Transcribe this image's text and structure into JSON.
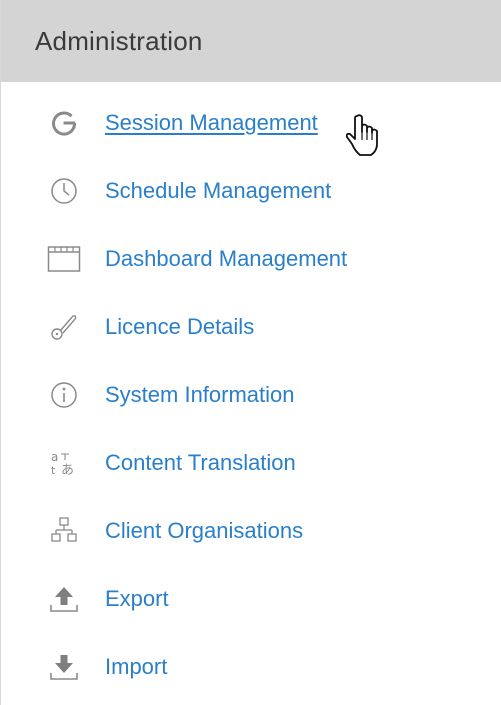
{
  "panel": {
    "title": "Administration"
  },
  "menu": {
    "items": [
      {
        "label": "Session Management",
        "icon": "session-icon",
        "active": true
      },
      {
        "label": "Schedule Management",
        "icon": "clock-icon"
      },
      {
        "label": "Dashboard Management",
        "icon": "dashboard-icon"
      },
      {
        "label": "Licence Details",
        "icon": "key-icon"
      },
      {
        "label": "System Information",
        "icon": "info-icon"
      },
      {
        "label": "Content Translation",
        "icon": "translation-icon"
      },
      {
        "label": "Client Organisations",
        "icon": "org-chart-icon"
      },
      {
        "label": "Export",
        "icon": "export-icon"
      },
      {
        "label": "Import",
        "icon": "import-icon"
      }
    ]
  },
  "colors": {
    "header_bg": "#d4d4d4",
    "link": "#2a7fc9",
    "icon": "#8a8a8a",
    "title": "#3a3a3a"
  }
}
